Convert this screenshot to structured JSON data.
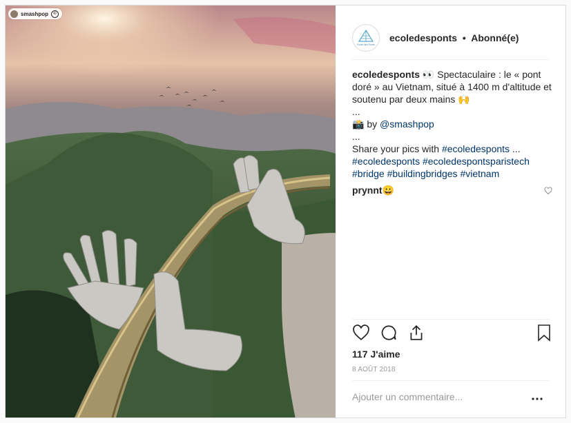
{
  "photo": {
    "tag_username": "smashpop"
  },
  "header": {
    "logo_text": "Ecole des Ponts",
    "username": "ecoledesponts",
    "separator": "•",
    "follow_status": "Abonné(e)"
  },
  "caption": {
    "username": "ecoledesponts",
    "text_line1": " 👀 Spectaculaire : le « pont doré » au Vietnam, situé à 1400 m d'altitude et soutenu par deux mains 🙌",
    "dots1": "...",
    "credit_prefix": "📸 by ",
    "credit_handle": "@smashpop",
    "dots2": "...",
    "share_text": "Share your pics with ",
    "tags_inline": "#ecoledesponts",
    "tags_suffix": " ...",
    "tags": [
      "#ecoledesponts",
      "#ecoledespontsparistech",
      "#bridge",
      "#buildingbridges",
      "#vietnam"
    ]
  },
  "comment": {
    "username": "prynnt",
    "text": " 😀"
  },
  "actions": {
    "likes": "117 J'aime",
    "date": "8 AOÛT 2018",
    "add_comment_placeholder": "Ajouter un commentaire...",
    "more_icon": "…"
  }
}
